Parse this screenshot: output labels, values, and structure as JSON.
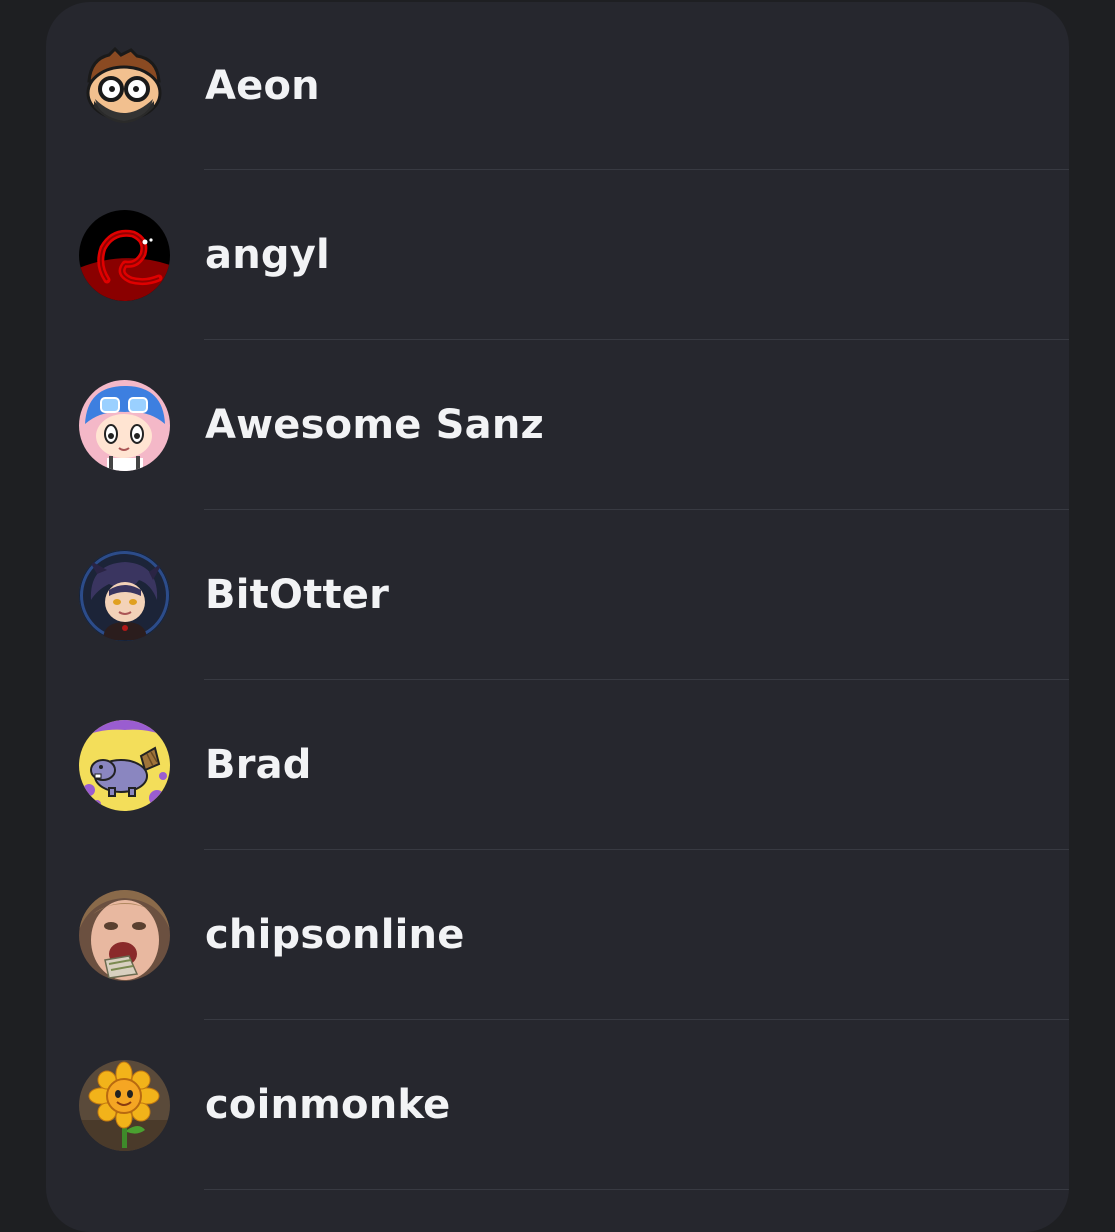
{
  "members": [
    {
      "name": "Aeon",
      "avatar_icon": "cartoon-masked-face-avatar"
    },
    {
      "name": "angyl",
      "avatar_icon": "red-squiggle-creature-avatar"
    },
    {
      "name": "Awesome Sanz",
      "avatar_icon": "blue-hair-goggles-avatar"
    },
    {
      "name": "BitOtter",
      "avatar_icon": "anime-dark-hair-avatar"
    },
    {
      "name": "Brad",
      "avatar_icon": "purple-beaver-avatar"
    },
    {
      "name": "chipsonline",
      "avatar_icon": "photo-person-eating-avatar"
    },
    {
      "name": "coinmonke",
      "avatar_icon": "sunflower-avatar"
    }
  ],
  "colors": {
    "background": "#1e1f22",
    "panel": "#26272e",
    "text": "#f2f3f5",
    "divider": "#383a42"
  }
}
